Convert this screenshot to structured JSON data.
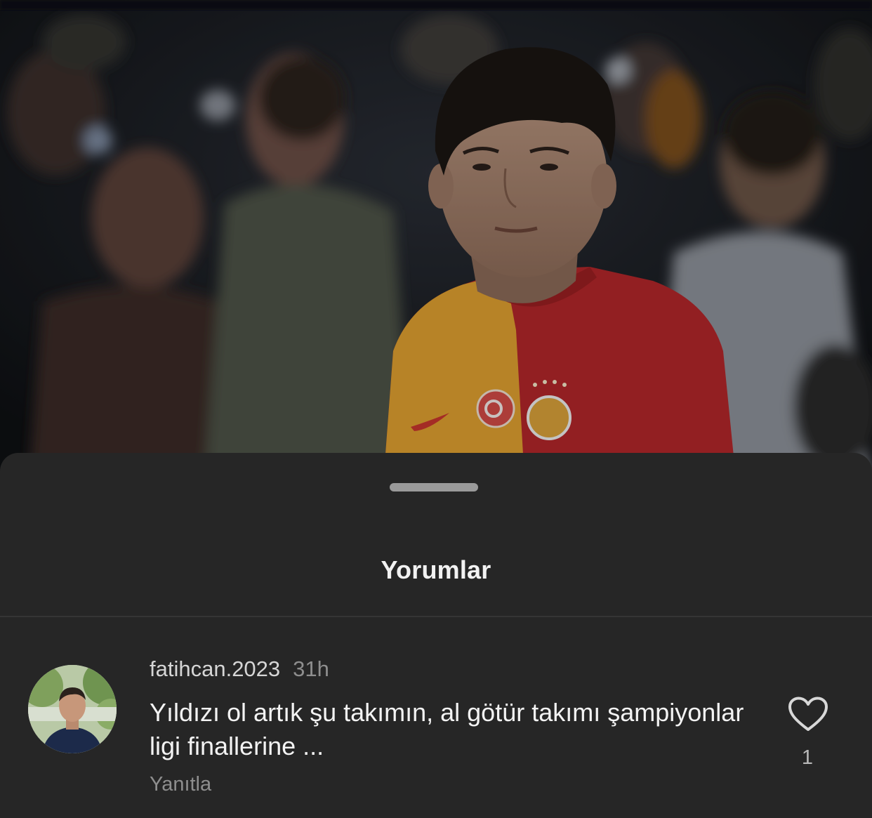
{
  "sheet": {
    "title": "Yorumlar"
  },
  "comment": {
    "username": "fatihcan.2023",
    "time": "31h",
    "text": "Yıldızı ol artık şu takımın, al götür takımı şampiyonlar ligi finallerine ...",
    "reply_label": "Yanıtla",
    "like_count": "1",
    "like_icon": "heart-outline-icon"
  },
  "colors": {
    "sheet_background": "#262626",
    "primary_text": "#f3f3f3",
    "secondary_text": "#8e8e8e",
    "jersey_yellow": "#e0a030",
    "jersey_red": "#b3262a"
  }
}
